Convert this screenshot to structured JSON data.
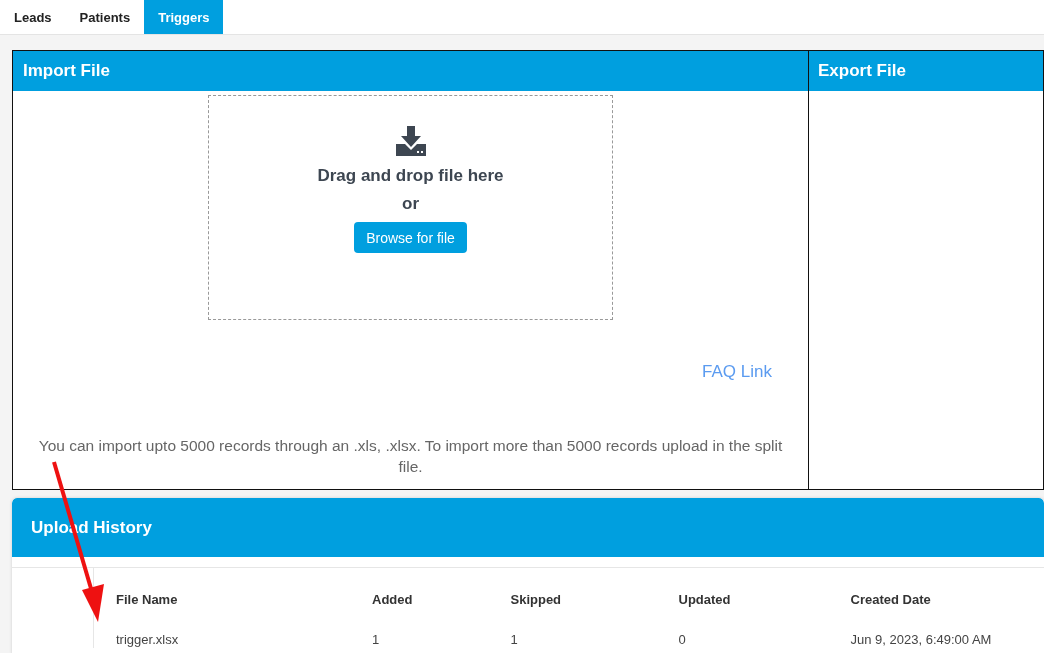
{
  "tabs": [
    {
      "label": "Leads",
      "selected": false
    },
    {
      "label": "Patients",
      "selected": false
    },
    {
      "label": "Triggers",
      "selected": true
    }
  ],
  "import_panel": {
    "title": "Import File",
    "drop_zone": {
      "heading": "Drag and drop file here",
      "separator": "or",
      "button": "Browse for file"
    },
    "faq_link": "FAQ Link",
    "note": "You can import upto 5000 records through an .xls, .xlsx. To import more than 5000 records upload in the split file."
  },
  "export_panel": {
    "title": "Export File"
  },
  "upload_history": {
    "title": "Upload History",
    "table": {
      "columns": [
        "File Name",
        "Added",
        "Skipped",
        "Updated",
        "Created Date"
      ],
      "rows": [
        [
          "trigger.xlsx",
          "1",
          "1",
          "0",
          "Jun 9, 2023, 6:49:00 AM"
        ]
      ]
    }
  }
}
